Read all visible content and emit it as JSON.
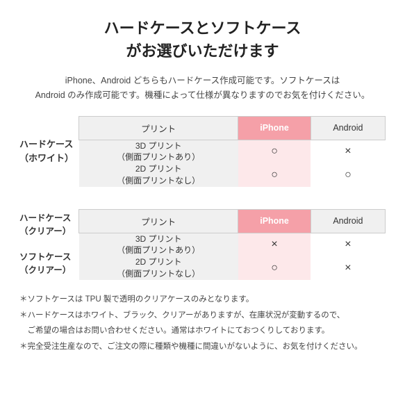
{
  "title_line1": "ハードケースとソフトケース",
  "title_line2": "がお選びいただけます",
  "subtitle": "iPhone、Android どちらもハードケース作成可能です。ソフトケースは\nAndroid のみ作成可能です。機種によって仕様が異なりますのでお気を付けください。",
  "table1": {
    "label": "ハードケース\n（ホワイト）",
    "headers": [
      "プリント",
      "iPhone",
      "Android"
    ],
    "rows": [
      {
        "print": "3D プリント\n（側面プリントあり）",
        "iphone": "○",
        "android": "×"
      },
      {
        "print": "2D プリント\n（側面プリントなし）",
        "iphone": "○",
        "android": "○"
      }
    ]
  },
  "table2": {
    "label": "ハードケース\n（クリアー）\nソフトケース\n（クリアー）",
    "headers": [
      "プリント",
      "iPhone",
      "Android"
    ],
    "rows": [
      {
        "print": "3D プリント\n（側面プリントあり）",
        "iphone": "×",
        "android": "×"
      },
      {
        "print": "2D プリント\n（側面プリントなし）",
        "iphone": "○",
        "android": "×"
      }
    ]
  },
  "notes": [
    "＊ソフトケースは TPU 製で透明のクリアケースのみとなります。",
    "＊ハードケースはホワイト、ブラック、クリアーがありますが、在庫状況が変動するので、",
    "　ご希望の場合はお問い合わせください。通常はホワイトにておつくりしております。",
    "＊完全受注生産なので、ご注文の際に種類や機種に間違いがないように、お気を付けください。"
  ]
}
